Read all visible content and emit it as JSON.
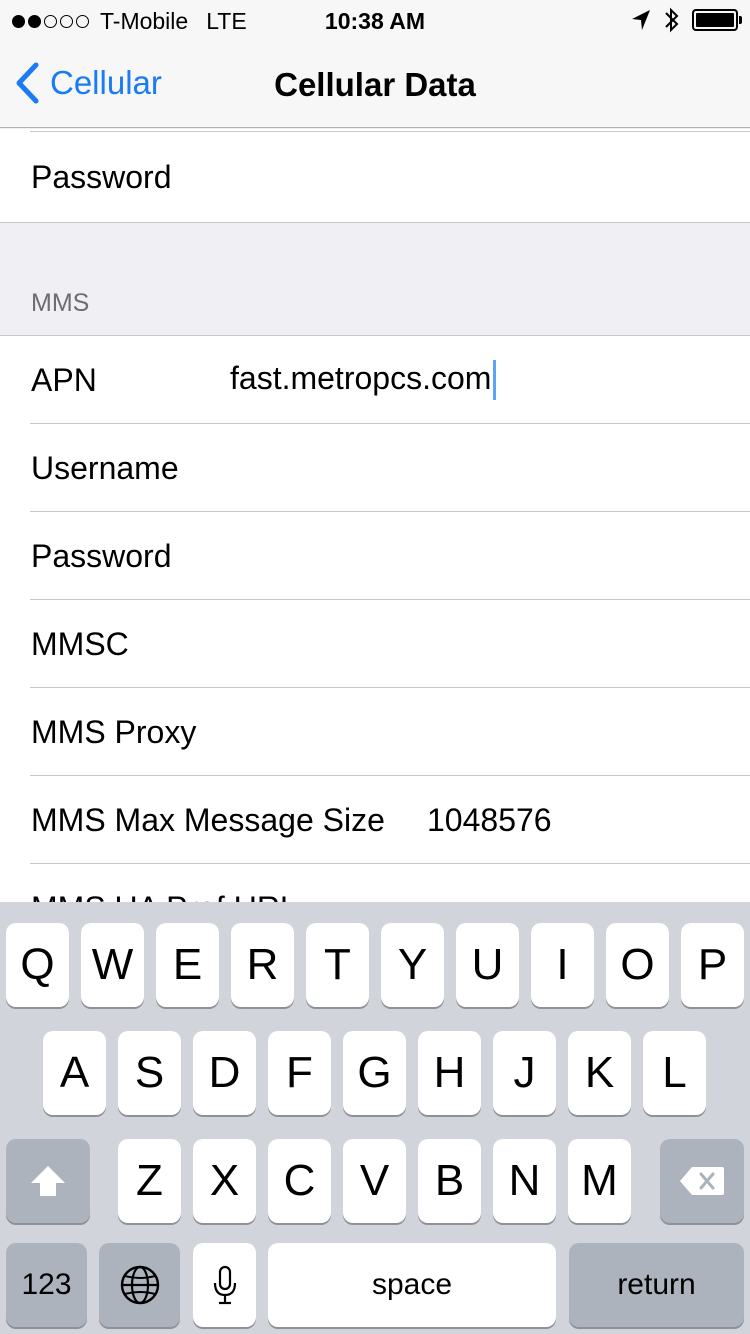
{
  "status_bar": {
    "carrier": "T-Mobile",
    "network": "LTE",
    "time": "10:38 AM"
  },
  "nav": {
    "back_label": "Cellular",
    "title": "Cellular Data"
  },
  "top_group": {
    "password_label": "Password"
  },
  "mms": {
    "header": "MMS",
    "apn_label": "APN",
    "apn_value": "fast.metropcs.com",
    "username_label": "Username",
    "password_label": "Password",
    "mmsc_label": "MMSC",
    "proxy_label": "MMS Proxy",
    "max_size_label": "MMS Max Message Size",
    "max_size_value": "1048576",
    "ua_prof_label": "MMS UA Prof URL"
  },
  "keyboard": {
    "row1": [
      "Q",
      "W",
      "E",
      "R",
      "T",
      "Y",
      "U",
      "I",
      "O",
      "P"
    ],
    "row2": [
      "A",
      "S",
      "D",
      "F",
      "G",
      "H",
      "J",
      "K",
      "L"
    ],
    "row3": [
      "Z",
      "X",
      "C",
      "V",
      "B",
      "N",
      "M"
    ],
    "numbers_label": "123",
    "space_label": "space",
    "return_label": "return"
  },
  "icons": {
    "back": "chevron-left-icon",
    "location": "location-arrow-icon",
    "bluetooth": "bluetooth-icon",
    "battery": "battery-icon",
    "shift": "shift-icon",
    "delete": "delete-icon",
    "globe": "globe-icon",
    "mic": "microphone-icon"
  },
  "colors": {
    "accent": "#1a7cf5",
    "background": "#efeff4",
    "keyboard_bg": "#d1d5db"
  }
}
